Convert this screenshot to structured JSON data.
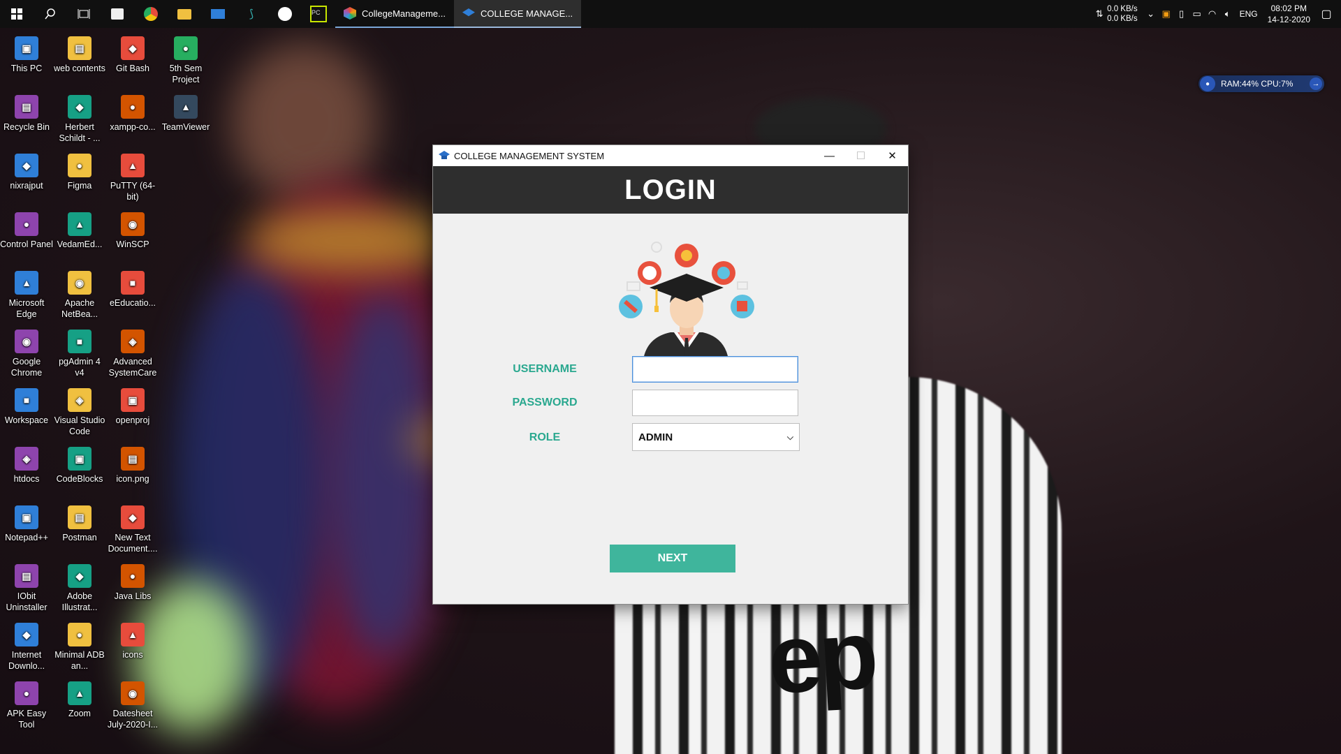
{
  "taskbar": {
    "apps": [
      {
        "label": "CollegeManageme..."
      },
      {
        "label": "COLLEGE MANAGE..."
      }
    ],
    "tray": {
      "net_up": "0.0 KB/s",
      "net_down": "0.0 KB/s",
      "language": "ENG",
      "time": "08:02 PM",
      "date": "14-12-2020"
    }
  },
  "ram_widget": {
    "text": "RAM:44%  CPU:7%"
  },
  "desktop": {
    "icons": [
      [
        "This PC",
        "web contents",
        "Git Bash",
        "5th Sem Project"
      ],
      [
        "Recycle Bin",
        "Herbert Schildt - ...",
        "xampp-co...",
        "TeamViewer"
      ],
      [
        "nixrajput",
        "Figma",
        "PuTTY (64-bit)"
      ],
      [
        "Control Panel",
        "VedamEd...",
        "WinSCP"
      ],
      [
        "Microsoft Edge",
        "Apache NetBea...",
        "eEducatio..."
      ],
      [
        "Google Chrome",
        "pgAdmin 4 v4",
        "Advanced SystemCare"
      ],
      [
        "Workspace",
        "Visual Studio Code",
        "openproj"
      ],
      [
        "htdocs",
        "CodeBlocks",
        "icon.png"
      ],
      [
        "Notepad++",
        "Postman",
        "New Text Document...."
      ],
      [
        "IObit Uninstaller",
        "Adobe Illustrat...",
        "Java Libs"
      ],
      [
        "Internet Downlo...",
        "Minimal ADB an...",
        "icons"
      ],
      [
        "APK Easy Tool",
        "Zoom",
        "Datesheet July-2020-I..."
      ]
    ]
  },
  "window": {
    "title": "COLLEGE MANAGEMENT SYSTEM",
    "header": "LOGIN",
    "username_label": "USERNAME",
    "username_value": "",
    "password_label": "PASSWORD",
    "password_value": "",
    "role_label": "ROLE",
    "role_value": "ADMIN",
    "next_label": "NEXT"
  },
  "colors": {
    "accent": "#3fb59c",
    "label": "#2aa88f",
    "header_bg": "#2e2e2e"
  }
}
